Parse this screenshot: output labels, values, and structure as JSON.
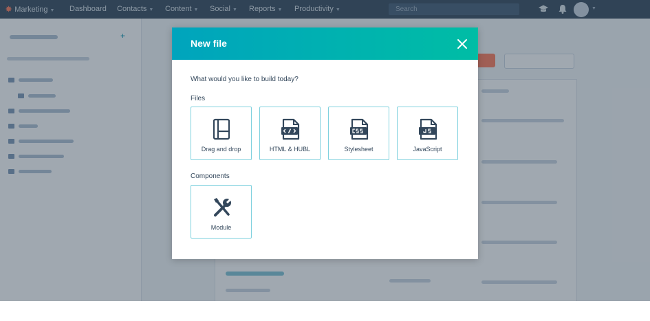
{
  "topnav": {
    "items": [
      {
        "label": "Marketing"
      },
      {
        "label": "Dashboard"
      },
      {
        "label": "Contacts"
      },
      {
        "label": "Content"
      },
      {
        "label": "Social"
      },
      {
        "label": "Reports"
      },
      {
        "label": "Productivity"
      }
    ],
    "search_placeholder": "Search"
  },
  "modal": {
    "title": "New file",
    "question": "What would you like to build today?",
    "files_label": "Files",
    "components_label": "Components",
    "files": [
      {
        "label": "Drag and drop",
        "icon": "drag-drop-layout-icon"
      },
      {
        "label": "HTML & HUBL",
        "icon": "html-file-icon"
      },
      {
        "label": "Stylesheet",
        "icon": "css-file-icon"
      },
      {
        "label": "JavaScript",
        "icon": "js-file-icon"
      }
    ],
    "components": [
      {
        "label": "Module",
        "icon": "wrench-screwdriver-icon"
      }
    ]
  },
  "colors": {
    "nav_bg": "#33475b",
    "header_gradient_start": "#00a4bd",
    "header_gradient_end": "#00bda5",
    "tile_border": "#7fd1de",
    "text": "#33475b"
  }
}
